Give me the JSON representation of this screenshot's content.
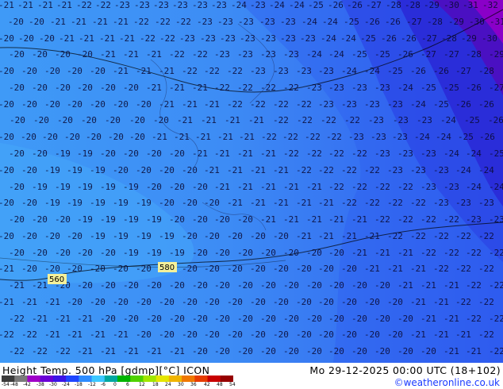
{
  "map": {
    "field": "Height Temp. 500 hPa",
    "units": "[gdmp][°C]",
    "model": "ICON",
    "valid_time": "Mo 29-12-2025 00:00 UTC (18+102)",
    "height_labels": [
      "560",
      "580"
    ],
    "temperature_rows": [
      [
        "21",
        "21",
        "21",
        "21",
        "22",
        "22",
        "23",
        "23",
        "23",
        "23",
        "23",
        "23",
        "24",
        "23",
        "24",
        "24",
        "25",
        "26",
        "26",
        "27",
        "28",
        "28",
        "29",
        "30",
        "31",
        "32"
      ],
      [
        "20",
        "20",
        "21",
        "21",
        "21",
        "21",
        "22",
        "22",
        "22",
        "23",
        "23",
        "23",
        "23",
        "23",
        "24",
        "24",
        "25",
        "26",
        "26",
        "27",
        "28",
        "29",
        "30",
        "31"
      ],
      [
        "20",
        "20",
        "20",
        "21",
        "21",
        "21",
        "21",
        "22",
        "22",
        "23",
        "23",
        "23",
        "23",
        "23",
        "23",
        "23",
        "24",
        "24",
        "25",
        "26",
        "26",
        "27",
        "28",
        "29",
        "30"
      ],
      [
        "20",
        "20",
        "20",
        "20",
        "21",
        "21",
        "21",
        "22",
        "22",
        "23",
        "23",
        "23",
        "23",
        "24",
        "24",
        "25",
        "25",
        "26",
        "27",
        "27",
        "28",
        "29"
      ],
      [
        "20",
        "20",
        "20",
        "20",
        "20",
        "21",
        "21",
        "21",
        "22",
        "22",
        "22",
        "23",
        "23",
        "23",
        "23",
        "24",
        "24",
        "25",
        "26",
        "26",
        "27",
        "28"
      ],
      [
        "20",
        "20",
        "20",
        "20",
        "20",
        "20",
        "21",
        "21",
        "21",
        "22",
        "22",
        "22",
        "22",
        "23",
        "23",
        "23",
        "23",
        "24",
        "25",
        "25",
        "26",
        "27"
      ],
      [
        "20",
        "20",
        "20",
        "20",
        "20",
        "20",
        "20",
        "21",
        "21",
        "21",
        "22",
        "22",
        "22",
        "22",
        "23",
        "23",
        "23",
        "23",
        "24",
        "25",
        "26",
        "26"
      ],
      [
        "20",
        "20",
        "20",
        "20",
        "20",
        "20",
        "20",
        "21",
        "21",
        "21",
        "21",
        "22",
        "22",
        "22",
        "22",
        "23",
        "23",
        "23",
        "24",
        "25",
        "26"
      ],
      [
        "20",
        "20",
        "20",
        "20",
        "20",
        "20",
        "20",
        "21",
        "21",
        "21",
        "21",
        "21",
        "22",
        "22",
        "22",
        "22",
        "23",
        "23",
        "23",
        "24",
        "24",
        "25",
        "26"
      ],
      [
        "20",
        "20",
        "19",
        "19",
        "20",
        "20",
        "20",
        "20",
        "21",
        "21",
        "21",
        "21",
        "22",
        "22",
        "22",
        "22",
        "23",
        "23",
        "23",
        "24",
        "24",
        "25"
      ],
      [
        "20",
        "20",
        "19",
        "19",
        "19",
        "20",
        "20",
        "20",
        "20",
        "21",
        "21",
        "21",
        "21",
        "22",
        "22",
        "22",
        "22",
        "23",
        "23",
        "23",
        "24",
        "24"
      ],
      [
        "20",
        "19",
        "19",
        "19",
        "19",
        "19",
        "20",
        "20",
        "20",
        "21",
        "21",
        "21",
        "21",
        "21",
        "22",
        "22",
        "22",
        "22",
        "23",
        "23",
        "24",
        "24"
      ],
      [
        "20",
        "20",
        "19",
        "19",
        "19",
        "19",
        "19",
        "20",
        "20",
        "20",
        "21",
        "21",
        "21",
        "21",
        "21",
        "22",
        "22",
        "22",
        "22",
        "23",
        "23",
        "23"
      ],
      [
        "20",
        "20",
        "20",
        "19",
        "19",
        "19",
        "19",
        "20",
        "20",
        "20",
        "20",
        "21",
        "21",
        "21",
        "21",
        "21",
        "22",
        "22",
        "22",
        "22",
        "23",
        "23"
      ],
      [
        "20",
        "20",
        "20",
        "20",
        "19",
        "19",
        "19",
        "19",
        "20",
        "20",
        "20",
        "20",
        "20",
        "21",
        "21",
        "21",
        "21",
        "22",
        "22",
        "22",
        "22",
        "22"
      ],
      [
        "20",
        "20",
        "20",
        "20",
        "20",
        "19",
        "19",
        "19",
        "20",
        "20",
        "20",
        "20",
        "20",
        "20",
        "20",
        "21",
        "21",
        "21",
        "22",
        "22",
        "22",
        "22"
      ],
      [
        "21",
        "20",
        "20",
        "20",
        "20",
        "20",
        "20",
        "19",
        "20",
        "20",
        "20",
        "20",
        "20",
        "20",
        "20",
        "20",
        "21",
        "21",
        "21",
        "22",
        "22",
        "22"
      ],
      [
        "21",
        "21",
        "20",
        "20",
        "20",
        "20",
        "20",
        "20",
        "20",
        "20",
        "20",
        "20",
        "20",
        "20",
        "20",
        "20",
        "20",
        "21",
        "21",
        "21",
        "22",
        "22"
      ],
      [
        "21",
        "21",
        "21",
        "20",
        "20",
        "20",
        "20",
        "20",
        "20",
        "20",
        "20",
        "20",
        "20",
        "20",
        "20",
        "20",
        "20",
        "20",
        "21",
        "21",
        "22",
        "22"
      ],
      [
        "22",
        "21",
        "21",
        "21",
        "20",
        "20",
        "20",
        "20",
        "20",
        "20",
        "20",
        "20",
        "20",
        "20",
        "20",
        "20",
        "20",
        "20",
        "21",
        "21",
        "22",
        "22"
      ],
      [
        "22",
        "22",
        "21",
        "21",
        "21",
        "21",
        "20",
        "20",
        "20",
        "20",
        "20",
        "20",
        "20",
        "20",
        "20",
        "20",
        "20",
        "20",
        "21",
        "21",
        "21",
        "22"
      ],
      [
        "22",
        "22",
        "22",
        "21",
        "21",
        "21",
        "21",
        "21",
        "20",
        "20",
        "20",
        "20",
        "20",
        "20",
        "20",
        "20",
        "20",
        "20",
        "20",
        "21",
        "21",
        "22"
      ]
    ]
  },
  "footer": {
    "title_left": "Height Temp. 500 hPa [gdmp][°C] ICON",
    "title_right": "Mo 29-12-2025 00:00 UTC (18+102)",
    "copyright": "©weatheronline.co.uk",
    "colorbar_ticks": [
      "-54",
      "-48",
      "-42",
      "-38",
      "-30",
      "-24",
      "-18",
      "-12",
      "-6",
      "0",
      "6",
      "12",
      "18",
      "24",
      "30",
      "36",
      "42",
      "48",
      "54"
    ],
    "colorbar_colors": [
      "#3c3c3c",
      "#7a7a7a",
      "#9f00c8",
      "#6a00d6",
      "#3c14e6",
      "#1e46ff",
      "#2d8cff",
      "#3cc8ff",
      "#00a8a0",
      "#00b400",
      "#50d200",
      "#a0e600",
      "#e6e600",
      "#f0b400",
      "#f07800",
      "#e63c00",
      "#c80000",
      "#960000"
    ]
  }
}
